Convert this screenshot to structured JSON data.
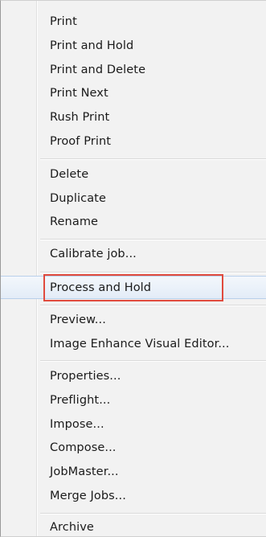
{
  "menu": {
    "groups": [
      {
        "items": [
          {
            "label": "Print"
          },
          {
            "label": "Print and Hold"
          },
          {
            "label": "Print and Delete"
          },
          {
            "label": "Print Next"
          },
          {
            "label": "Rush Print"
          },
          {
            "label": "Proof Print"
          }
        ]
      },
      {
        "items": [
          {
            "label": "Delete"
          },
          {
            "label": "Duplicate"
          },
          {
            "label": "Rename"
          }
        ]
      },
      {
        "items": [
          {
            "label": "Calibrate job..."
          }
        ]
      },
      {
        "items": [
          {
            "label": "Process and Hold",
            "highlighted": true
          }
        ]
      },
      {
        "items": [
          {
            "label": "Preview..."
          },
          {
            "label": "Image Enhance Visual Editor..."
          }
        ]
      },
      {
        "items": [
          {
            "label": "Properties..."
          },
          {
            "label": "Preflight..."
          },
          {
            "label": "Impose..."
          },
          {
            "label": "Compose..."
          },
          {
            "label": "JobMaster..."
          },
          {
            "label": "Merge Jobs..."
          }
        ]
      },
      {
        "items": [
          {
            "label": "Archive"
          }
        ]
      }
    ]
  },
  "colors": {
    "highlight_border": "#e04b3e",
    "hover_border": "#b9d0ea"
  }
}
